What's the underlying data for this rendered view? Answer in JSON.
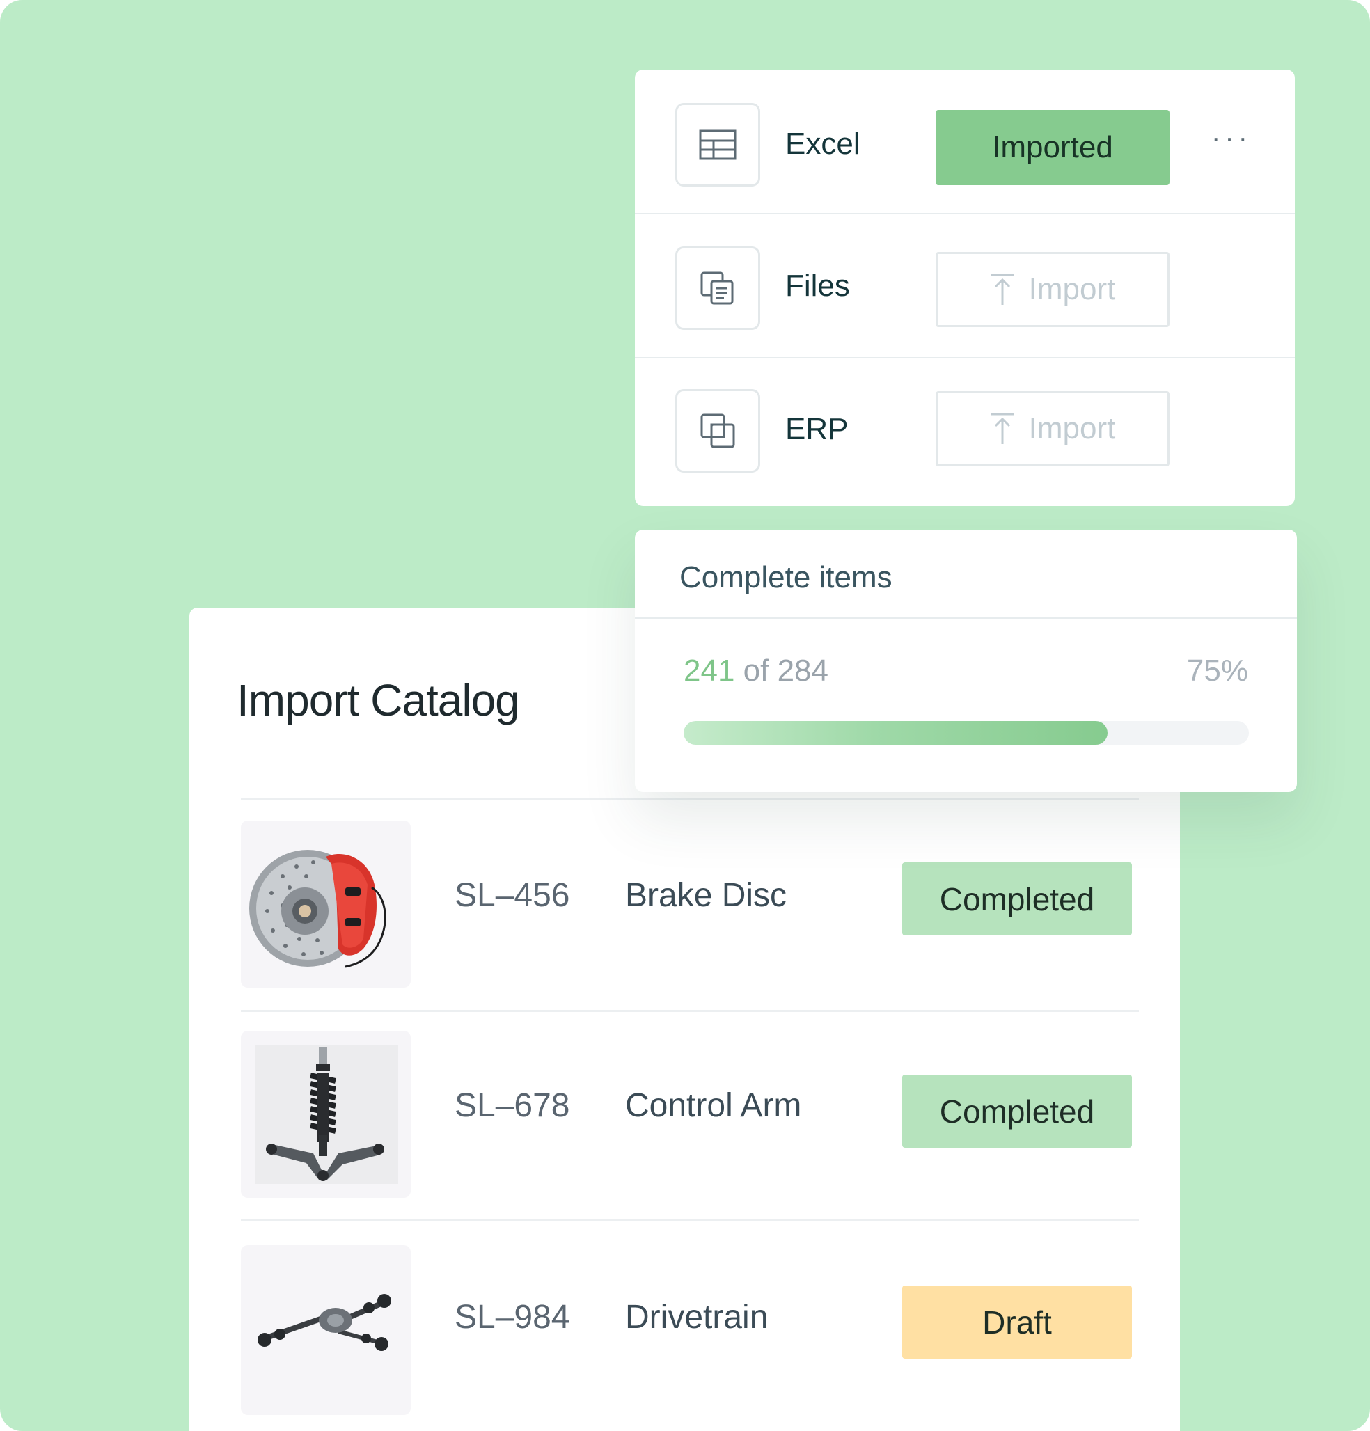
{
  "sources": [
    {
      "label": "Excel",
      "icon": "table-icon",
      "action_label": "Imported",
      "state": "imported"
    },
    {
      "label": "Files",
      "icon": "files-icon",
      "action_label": "Import",
      "state": "pending"
    },
    {
      "label": "ERP",
      "icon": "erp-icon",
      "action_label": "Import",
      "state": "pending"
    }
  ],
  "more_menu": "···",
  "progress": {
    "title": "Complete items",
    "done": "241",
    "of_total": "of 284",
    "percent_label": "75%",
    "fraction": 0.75
  },
  "catalog": {
    "title": "Import Catalog",
    "rows": [
      {
        "sku": "SL–456",
        "name": "Brake Disc",
        "status": "Completed",
        "status_type": "completed"
      },
      {
        "sku": "SL–678",
        "name": "Control Arm",
        "status": "Completed",
        "status_type": "completed"
      },
      {
        "sku": "SL–984",
        "name": "Drivetrain",
        "status": "Draft",
        "status_type": "draft"
      }
    ]
  },
  "colors": {
    "background": "#bcebc7",
    "accent_green": "#86cb8f",
    "completed_bg": "#b6e3bd",
    "draft_bg": "#ffe0a3"
  }
}
